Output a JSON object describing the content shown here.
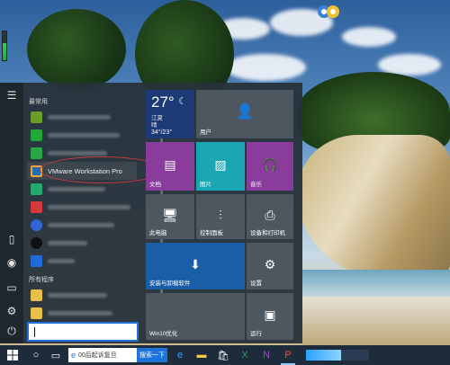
{
  "start_menu": {
    "section_frequent": "最常用",
    "section_all": "所有程序",
    "highlight_app": "VMware Workstation Pro",
    "apps_frequent": [
      {
        "color": "#6a9e2a"
      },
      {
        "color": "#22a839"
      },
      {
        "color": "#26a844"
      },
      {
        "color": "#1f6fb3",
        "label": "VMware Workstation Pro"
      },
      {
        "color": "#25a86b"
      },
      {
        "color": "#d33a3a"
      },
      {
        "color": "#3066d8"
      },
      {
        "color": "#111111"
      },
      {
        "color": "#1e6cd8"
      }
    ],
    "apps_all": [
      {
        "color": "#e6c048"
      },
      {
        "color": "#e6c048"
      }
    ]
  },
  "tiles": {
    "weather": {
      "temp": "27°",
      "place": "江夏\n晴",
      "range": "34°/23°"
    },
    "user": "用户",
    "documents": "文档",
    "pictures": "图片",
    "music": "音乐",
    "this_pc": "此电脑",
    "control_panel": "控制面板",
    "devices_printers": "设备和打印机",
    "install_uninstall": "安装与卸载软件",
    "settings": "设置",
    "win10_optimize": "Win10优化",
    "run": "运行"
  },
  "taskbar": {
    "search_text": "00后起诉复旦",
    "search_button": "搜索一下",
    "progress": 0.55
  },
  "colors": {
    "tile_purple": "#8a3c9c",
    "tile_teal": "#1aa6b5",
    "tile_blue": "#1b5ea8",
    "tile_weather": "#1c3a75"
  }
}
